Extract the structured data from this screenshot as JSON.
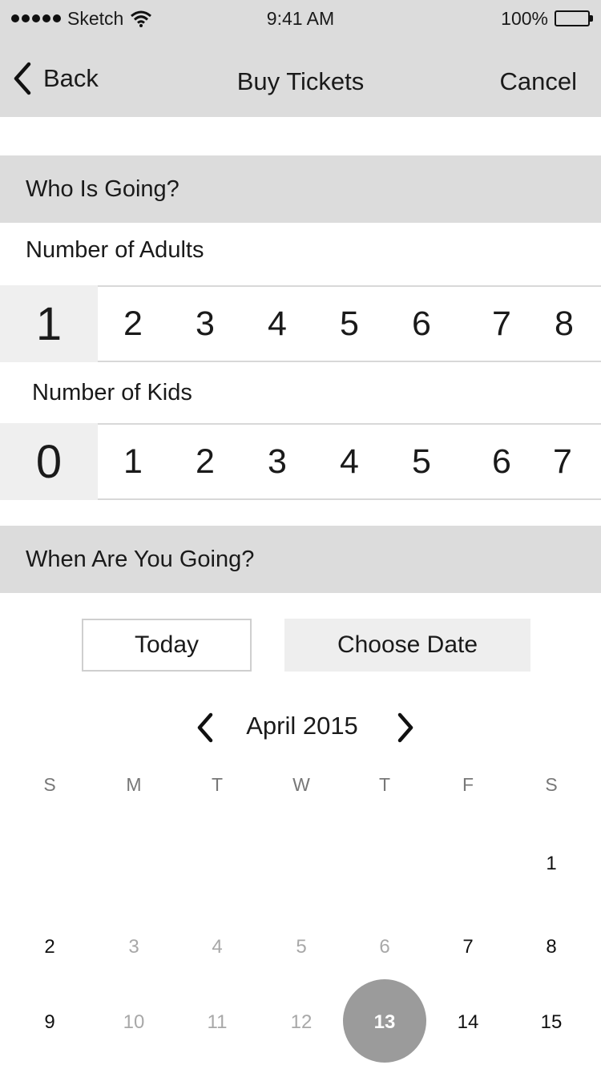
{
  "status_bar": {
    "carrier": "Sketch",
    "time": "9:41 AM",
    "battery": "100%"
  },
  "nav": {
    "back_label": "Back",
    "title": "Buy Tickets",
    "cancel_label": "Cancel"
  },
  "section_who": {
    "title": "Who Is Going?"
  },
  "adults": {
    "label": "Number of Adults",
    "selected": "1",
    "options": [
      "2",
      "3",
      "4",
      "5",
      "6",
      "7",
      "8"
    ]
  },
  "kids": {
    "label": "Number of Kids",
    "selected": "0",
    "options": [
      "1",
      "2",
      "3",
      "4",
      "5",
      "6",
      "7"
    ]
  },
  "section_when": {
    "title": "When Are You Going?"
  },
  "date_buttons": {
    "today": "Today",
    "choose": "Choose Date"
  },
  "calendar": {
    "month_label": "April 2015",
    "weekdays": [
      "S",
      "M",
      "T",
      "W",
      "T",
      "F",
      "S"
    ],
    "row1": [
      "1"
    ],
    "row2": [
      "2",
      "3",
      "4",
      "5",
      "6",
      "7",
      "8"
    ],
    "row3": [
      "9",
      "10",
      "11",
      "12",
      "13",
      "14",
      "15"
    ],
    "selected_day": "13"
  },
  "colors": {
    "header_bg": "#dcdcdc",
    "selected_bg": "#efefef",
    "selected_circle": "#9b9b9b",
    "muted_text": "#a8a8a8"
  }
}
